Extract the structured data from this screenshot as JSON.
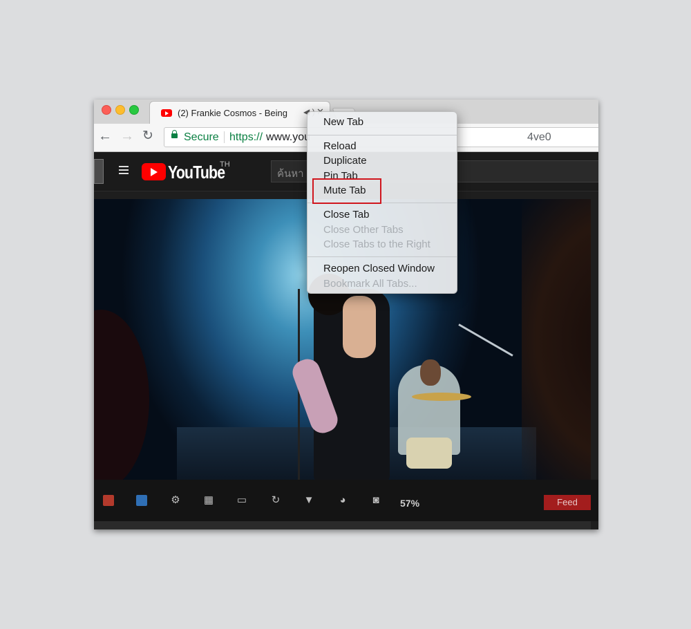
{
  "tab": {
    "title": "(2) Frankie Cosmos - Being",
    "audio_icon": "speaker-icon",
    "close_icon": "close-icon"
  },
  "toolbar": {
    "back": "←",
    "forward": "→",
    "reload": "↻",
    "secure_label": "Secure",
    "url_scheme": "https://",
    "url_host": "www.you",
    "url_tail": "4ve0"
  },
  "youtube": {
    "logo_text": "YouTube",
    "region": "TH",
    "search_placeholder": "ค้นหา"
  },
  "context_menu": {
    "items": [
      {
        "label": "New Tab",
        "enabled": true
      },
      {
        "label": "Reload",
        "enabled": true
      },
      {
        "label": "Duplicate",
        "enabled": true
      },
      {
        "label": "Pin Tab",
        "enabled": true
      },
      {
        "label": "Mute Tab",
        "enabled": true,
        "highlighted": true
      },
      {
        "label": "Close Tab",
        "enabled": true
      },
      {
        "label": "Close Other Tabs",
        "enabled": false
      },
      {
        "label": "Close Tabs to the Right",
        "enabled": false
      },
      {
        "label": "Reopen Closed Window",
        "enabled": true
      },
      {
        "label": "Bookmark All Tabs...",
        "enabled": false
      }
    ]
  },
  "controls": {
    "icons": [
      "red-icon",
      "blue-icon",
      "gear-icon",
      "film-icon",
      "picture-icon",
      "rotate-icon",
      "filter-icon",
      "palette-icon",
      "camera-icon"
    ],
    "gear": "⚙",
    "film": "▦",
    "picture": "▭",
    "rotate": "↻",
    "filter": "▼",
    "palette": "◕",
    "camera": "◙",
    "percent": "57%",
    "feed_label": "Feed"
  },
  "colors": {
    "highlight_box": "#d0161e",
    "feed_bg": "#a31d1d",
    "youtube_red": "#ff0000"
  }
}
